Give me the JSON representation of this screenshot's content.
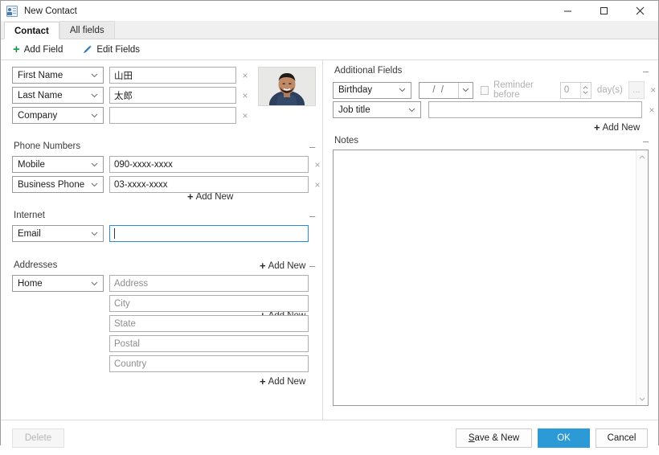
{
  "window": {
    "title": "New Contact",
    "icon": "contact-card-icon",
    "buttons": {
      "minimize": "–",
      "maximize": "□",
      "close": "✕"
    }
  },
  "tabs": [
    {
      "label": "Contact",
      "active": true
    },
    {
      "label": "All fields",
      "active": false
    }
  ],
  "toolbar": {
    "add_field": "Add Field",
    "edit_fields": "Edit Fields"
  },
  "left_panel": {
    "name_rows": [
      {
        "type": "First Name",
        "value": "山田",
        "placeholder": "",
        "remove": "×"
      },
      {
        "type": "Last Name",
        "value": "太郎",
        "placeholder": "",
        "remove": "×"
      },
      {
        "type": "Company",
        "value": "",
        "placeholder": "",
        "remove": "×"
      }
    ],
    "name_add_new": "Add New",
    "phone": {
      "label": "Phone Numbers",
      "collapse": "–",
      "rows": [
        {
          "type": "Mobile",
          "value": "090-xxxx-xxxx",
          "remove": "×"
        },
        {
          "type": "Business Phone",
          "value": "03-xxxx-xxxx",
          "remove": "×"
        }
      ],
      "add_new": "Add New"
    },
    "internet": {
      "label": "Internet",
      "collapse": "–",
      "rows": [
        {
          "type": "Email",
          "value": "",
          "focused": true
        }
      ],
      "add_new": "Add New"
    },
    "addresses": {
      "label": "Addresses",
      "collapse": "–",
      "type": "Home",
      "fields": [
        {
          "placeholder": "Address"
        },
        {
          "placeholder": "City"
        },
        {
          "placeholder": "State"
        },
        {
          "placeholder": "Postal"
        },
        {
          "placeholder": "Country"
        }
      ],
      "add_new": "Add New"
    }
  },
  "right_panel": {
    "additional": {
      "label": "Additional Fields",
      "collapse": "–",
      "birthday": {
        "type": "Birthday",
        "date_value": "/  /",
        "reminder_label": "Reminder before",
        "reminder_checked": false,
        "days_value": "0",
        "days_unit": "day(s)",
        "more_button": "...",
        "remove": "×"
      },
      "job": {
        "type": "Job title",
        "value": "",
        "remove": "×"
      },
      "add_new": "Add New"
    },
    "notes": {
      "label": "Notes",
      "collapse": "–",
      "value": ""
    }
  },
  "footer": {
    "delete": "Delete",
    "save_new_prefix": "S",
    "save_new_rest": "ave & New",
    "ok": "OK",
    "cancel": "Cancel"
  },
  "colors": {
    "accent": "#2b9ad6",
    "add_icon_green": "#139a43",
    "edit_icon_blue": "#2f7fc1",
    "focus_border": "#2c8bd6"
  }
}
